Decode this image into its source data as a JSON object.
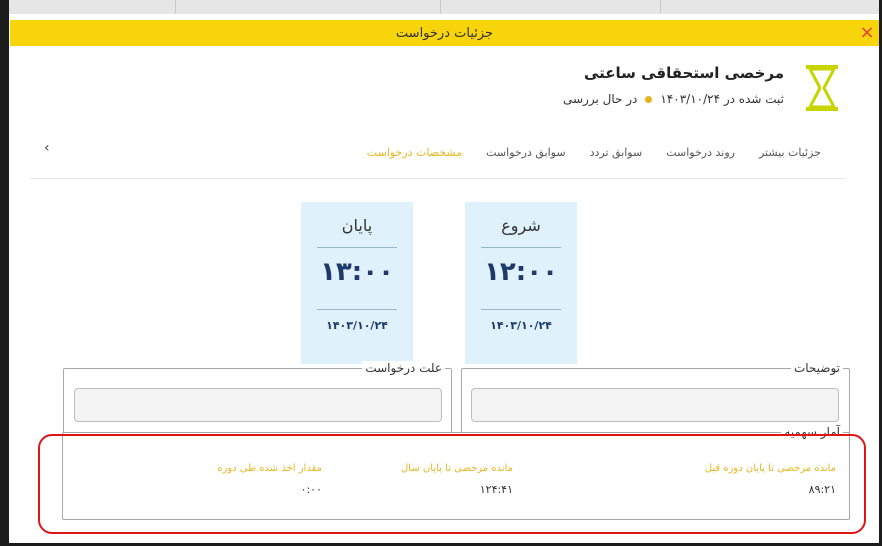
{
  "modal": {
    "title": "جزئیات درخواست",
    "close_glyph": "×"
  },
  "request": {
    "title": "مرخصی استحقاقی ساعتی",
    "registered": "ثبت شده در ۱۴۰۳/۱۰/۲۴",
    "status": "در حال بررسی",
    "status_color": "#e9b21f",
    "icon": "hourglass-icon"
  },
  "tabs": [
    {
      "label": "مشخصات درخواست",
      "active": true
    },
    {
      "label": "سوابق درخواست"
    },
    {
      "label": "سوابق تردد"
    },
    {
      "label": "روند درخواست"
    },
    {
      "label": "جزئیات بیشتر"
    }
  ],
  "tabs_arrow": "‹",
  "times": {
    "start": {
      "label": "شروع",
      "time": "۱۲:۰۰",
      "date": "۱۴۰۳/۱۰/۲۴"
    },
    "end": {
      "label": "پایان",
      "time": "۱۳:۰۰",
      "date": "۱۴۰۳/۱۰/۲۴"
    }
  },
  "fields": {
    "description_label": "توضیحات",
    "reason_label": "علت درخواست"
  },
  "quota": {
    "title": "آمار سهمیه",
    "items": [
      {
        "label": "مانده مرخصی تا پایان دوره قبل",
        "value": "۸۹:۲۱"
      },
      {
        "label": "مانده مرخصی تا پایان سال",
        "value": "۱۲۴:۴۱"
      },
      {
        "label": "مقدار اخذ شده طی دوره",
        "value": "۰:۰۰"
      }
    ]
  },
  "colors": {
    "accent": "#f8d40b",
    "tab_active": "#e8b620",
    "card_bg": "#dff1fb",
    "highlight": "#e01515"
  }
}
